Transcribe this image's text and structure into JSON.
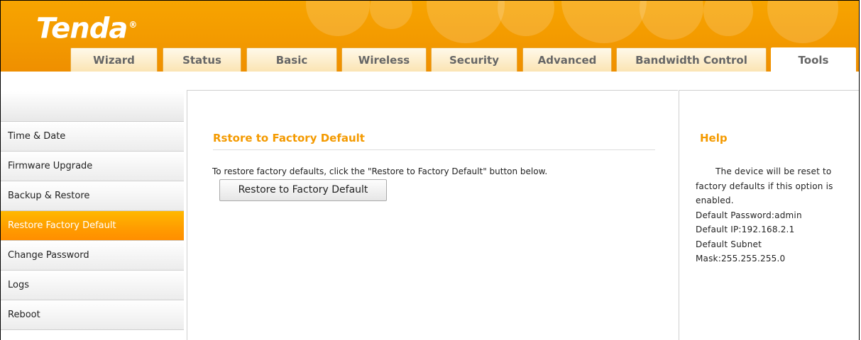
{
  "brand": {
    "logo_text": "Tenda",
    "registered_mark": "®",
    "header_color": "#f49a00",
    "accent_color": "#ff9c00"
  },
  "tabs": [
    {
      "label": "Wizard",
      "active": false
    },
    {
      "label": "Status",
      "active": false
    },
    {
      "label": "Basic",
      "active": false
    },
    {
      "label": "Wireless",
      "active": false
    },
    {
      "label": "Security",
      "active": false
    },
    {
      "label": "Advanced",
      "active": false
    },
    {
      "label": "Bandwidth Control",
      "active": false
    },
    {
      "label": "Tools",
      "active": true
    }
  ],
  "sidebar": {
    "items": [
      {
        "label": "Time & Date",
        "active": false
      },
      {
        "label": "Firmware Upgrade",
        "active": false
      },
      {
        "label": "Backup & Restore",
        "active": false
      },
      {
        "label": "Restore Factory Default",
        "active": true
      },
      {
        "label": "Change Password",
        "active": false
      },
      {
        "label": "Logs",
        "active": false
      },
      {
        "label": "Reboot",
        "active": false
      }
    ]
  },
  "main": {
    "title": "Rstore to Factory Default",
    "description": "To restore factory defaults, click the \"Restore to Factory Default\" button below.",
    "restore_button_label": "Restore to Factory Default"
  },
  "help": {
    "title": "Help",
    "lines": [
      "The device will be reset to factory defaults if this option is enabled.",
      "Default Password:admin",
      "Default IP:192.168.2.1",
      "Default Subnet Mask:255.255.255.0"
    ]
  }
}
